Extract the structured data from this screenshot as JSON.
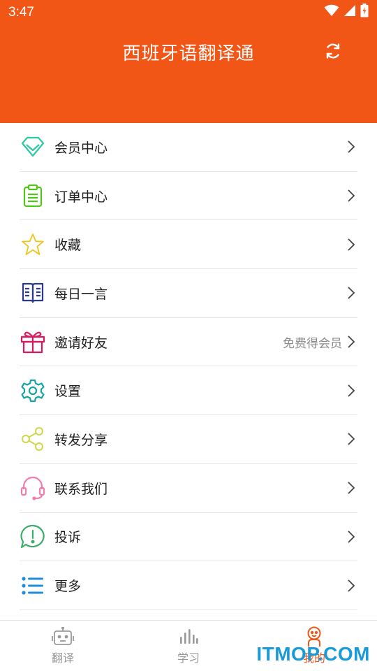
{
  "status_bar": {
    "time": "3:47"
  },
  "header": {
    "title": "西班牙语翻译通",
    "refresh_icon": "refresh-icon"
  },
  "menu": [
    {
      "id": "vip",
      "label": "会员中心",
      "icon": "diamond-icon",
      "color": "#2ec9a0",
      "hint": ""
    },
    {
      "id": "orders",
      "label": "订单中心",
      "icon": "clipboard-icon",
      "color": "#52c41a",
      "hint": ""
    },
    {
      "id": "favorites",
      "label": "收藏",
      "icon": "star-icon",
      "color": "#f0c419",
      "hint": ""
    },
    {
      "id": "daily",
      "label": "每日一言",
      "icon": "book-icon",
      "color": "#2b3a8c",
      "hint": ""
    },
    {
      "id": "invite",
      "label": "邀请好友",
      "icon": "gift-icon",
      "color": "#d81b60",
      "hint": "免费得会员"
    },
    {
      "id": "settings",
      "label": "设置",
      "icon": "gear-icon",
      "color": "#1aa3a3",
      "hint": ""
    },
    {
      "id": "share",
      "label": "转发分享",
      "icon": "share-icon",
      "color": "#d4d44a",
      "hint": ""
    },
    {
      "id": "contact",
      "label": "联系我们",
      "icon": "headset-icon",
      "color": "#f07fb0",
      "hint": ""
    },
    {
      "id": "complaint",
      "label": "投诉",
      "icon": "alert-bubble-icon",
      "color": "#3cae6a",
      "hint": ""
    },
    {
      "id": "more",
      "label": "更多",
      "icon": "list-icon",
      "color": "#1e8fd6",
      "hint": ""
    }
  ],
  "bottom_nav": [
    {
      "id": "translate",
      "label": "翻译",
      "icon": "robot-icon",
      "active": false
    },
    {
      "id": "study",
      "label": "学习",
      "icon": "bars-icon",
      "active": false
    },
    {
      "id": "mine",
      "label": "我的",
      "icon": "person-icon",
      "active": true
    }
  ],
  "watermark": "ITMOP.COM",
  "colors": {
    "accent": "#f25616",
    "divider": "#e6e6e6",
    "hint_text": "#8a8a8a"
  }
}
